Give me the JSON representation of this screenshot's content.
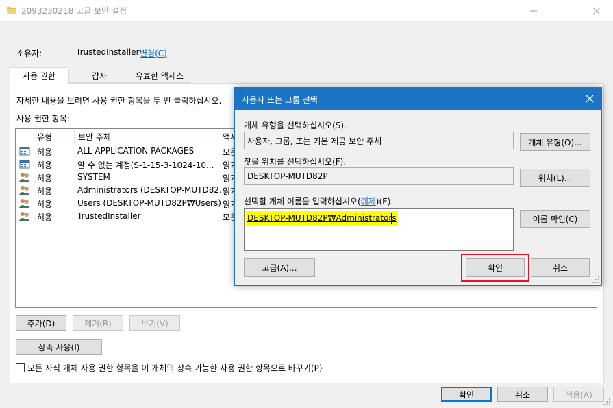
{
  "window": {
    "title": "2093230218 고급 보안 설정",
    "minimize_icon": "minimize-icon",
    "maximize_icon": "maximize-icon",
    "close_icon": "close-icon"
  },
  "owner": {
    "label": "소유자:",
    "value": "TrustedInstaller",
    "change_link": "변경(C)"
  },
  "tabs": [
    {
      "label": "사용 권한",
      "active": true
    },
    {
      "label": "감사",
      "active": false
    },
    {
      "label": "유효한 액세스",
      "active": false
    }
  ],
  "instructions": "자세한 내용을 보려면 사용 권한 항목을 두 번 클릭하십시오.",
  "entries_label": "사용 권한 항목:",
  "columns": [
    "유형",
    "보안 주체",
    "액세"
  ],
  "rows": [
    {
      "icon": "app-package-icon",
      "type": "허용",
      "principal": "ALL APPLICATION PACKAGES",
      "access": "모든"
    },
    {
      "icon": "app-package-icon",
      "type": "허용",
      "principal": "알 수 없는 계정(S-1-15-3-1024-10...",
      "access": "읽기"
    },
    {
      "icon": "users-group-icon",
      "type": "허용",
      "principal": "SYSTEM",
      "access": "읽기"
    },
    {
      "icon": "users-group-icon",
      "type": "허용",
      "principal": "Administrators (DESKTOP-MUTD82...",
      "access": "읽기"
    },
    {
      "icon": "users-group-icon",
      "type": "허용",
      "principal": "Users (DESKTOP-MUTD82P₩Users)",
      "access": "읽기"
    },
    {
      "icon": "users-group-icon",
      "type": "허용",
      "principal": "TrustedInstaller",
      "access": "모든"
    }
  ],
  "list_buttons": {
    "add": "추가(D)",
    "remove": "제거(R)",
    "view": "보기(V)"
  },
  "inherit_button": "상속 사용(I)",
  "replace_checkbox": {
    "label": "모든 자식 개체 사용 권한 항목을 이 개체의 상속 가능한 사용 권한 항목으로 바꾸기(P)",
    "checked": false
  },
  "footer": {
    "ok": "확인",
    "cancel": "취소",
    "apply": "적용(A)"
  },
  "dialog": {
    "title": "사용자 또는 그룹 선택",
    "object_type_label": "개체 유형을 선택하십시오(S).",
    "object_type_value": "사용자, 그룹, 또는 기본 제공 보안 주체",
    "object_type_button": "개체 유형(O)...",
    "location_label": "찾을 위치를 선택하십시오(F).",
    "location_value": "DESKTOP-MUTD82P",
    "location_button": "위치(L)...",
    "name_label_prefix": "선택할 개체 이름을 입력하십시오(",
    "name_label_link": "예제",
    "name_label_suffix": ")(E).",
    "name_value": "DESKTOP-MUTD82P₩Administrators",
    "check_names_button": "이름 확인(C)",
    "advanced_button": "고급(A)...",
    "ok_button": "확인",
    "cancel_button": "취소"
  },
  "colors": {
    "accent": "#1c74c4",
    "highlight": "#ffff00",
    "ok_outline": "#e81123",
    "link": "#0066cc"
  }
}
